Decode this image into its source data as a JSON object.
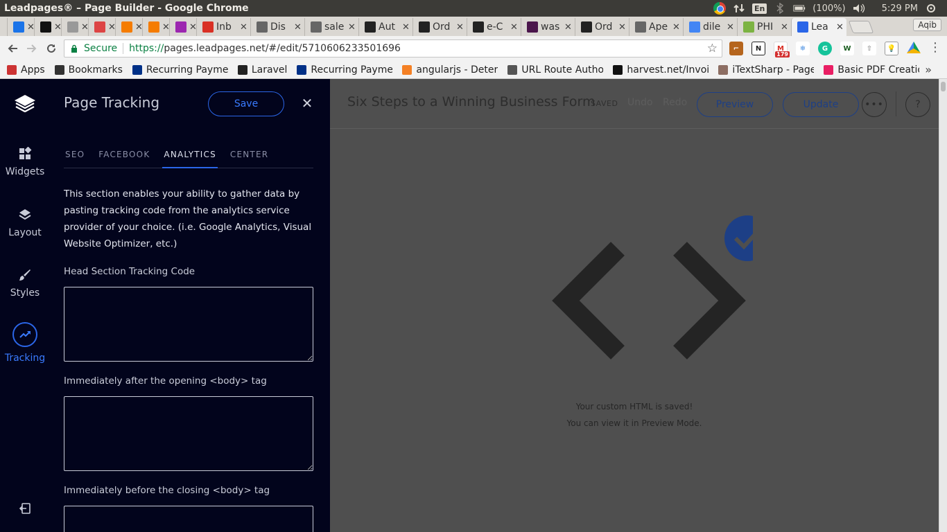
{
  "os": {
    "window_title": "Leadpages® – Page Builder - Google Chrome",
    "lang": "En",
    "battery": "(100%)",
    "time": "5:29 PM"
  },
  "tabs": [
    {
      "label": "",
      "icon": "refresh-favicon",
      "color": "#1a73e8"
    },
    {
      "label": "",
      "icon": "github-favicon",
      "color": "#111111"
    },
    {
      "label": "",
      "icon": "grid-favicon",
      "color": "#999999"
    },
    {
      "label": "",
      "icon": "tessel-favicon",
      "color": "#d44"
    },
    {
      "label": "",
      "icon": "bitbucket-favicon",
      "color": "#f57c00"
    },
    {
      "label": "",
      "icon": "bitbucket-favicon",
      "color": "#f57c00"
    },
    {
      "label": "",
      "icon": "prism-favicon",
      "color": "#9c27b0"
    },
    {
      "label": "Inb",
      "icon": "gmail-favicon",
      "color": "#d93025"
    },
    {
      "label": "Dis",
      "icon": "doc-favicon",
      "color": "#666666"
    },
    {
      "label": "sale",
      "icon": "doc-favicon",
      "color": "#666666"
    },
    {
      "label": "Aut",
      "icon": "bc-favicon",
      "color": "#222222"
    },
    {
      "label": "Ord",
      "icon": "bc-favicon",
      "color": "#222222"
    },
    {
      "label": "e-C",
      "icon": "bc-favicon",
      "color": "#222222"
    },
    {
      "label": "was",
      "icon": "slack-favicon",
      "color": "#4a154b"
    },
    {
      "label": "Ord",
      "icon": "bc-favicon",
      "color": "#222222"
    },
    {
      "label": "Ape",
      "icon": "doc-favicon",
      "color": "#666666"
    },
    {
      "label": "dile",
      "icon": "google-favicon",
      "color": "#4285f4"
    },
    {
      "label": "PHI",
      "icon": "php-favicon",
      "color": "#7cb342"
    },
    {
      "label": "Lea",
      "icon": "leadpages-favicon",
      "color": "#2b66e8",
      "active": true
    }
  ],
  "profile_name": "Aqib",
  "address": {
    "secure_label": "Secure",
    "url_scheme": "https://",
    "url_rest": "pages.leadpages.net/#/edit/5710606233501696"
  },
  "ext_badge": "179",
  "bookmarks": [
    {
      "label": "Apps",
      "icon": "apps-icon",
      "color": "#c33"
    },
    {
      "label": "Bookmarks",
      "icon": "star-icon",
      "color": "#333"
    },
    {
      "label": "Recurring Paymen",
      "icon": "paypal-icon",
      "color": "#003087"
    },
    {
      "label": "Laravel",
      "icon": "laravel-icon",
      "color": "#222"
    },
    {
      "label": "Recurring Paymen",
      "icon": "paypal-icon",
      "color": "#003087"
    },
    {
      "label": "angularjs - Determ",
      "icon": "stackoverflow-icon",
      "color": "#f48024"
    },
    {
      "label": "URL Route Author",
      "icon": "list-icon",
      "color": "#555"
    },
    {
      "label": "harvest.net/Invoic",
      "icon": "github-icon",
      "color": "#111"
    },
    {
      "label": "iTextSharp - Page l",
      "icon": "person-icon",
      "color": "#8d6e63"
    },
    {
      "label": "Basic PDF Creatio",
      "icon": "flask-icon",
      "color": "#e91e63"
    }
  ],
  "leftnav": [
    {
      "label": "Widgets",
      "icon": "widgets-icon"
    },
    {
      "label": "Layout",
      "icon": "layers-icon"
    },
    {
      "label": "Styles",
      "icon": "brush-icon"
    },
    {
      "label": "Tracking",
      "icon": "trending-icon",
      "active": true
    }
  ],
  "panel": {
    "title": "Page Tracking",
    "save_label": "Save",
    "tabs": [
      "SEO",
      "FACEBOOK",
      "ANALYTICS",
      "CENTER"
    ],
    "active_tab": "ANALYTICS",
    "description": "This section enables your ability to gather data by pasting tracking code from the analytics service provider of your choice. (i.e. Google Analytics, Visual Website Optimizer, etc.)",
    "fields": [
      {
        "label": "Head Section Tracking Code",
        "value": ""
      },
      {
        "label": "Immediately after the opening <body> tag",
        "value": ""
      },
      {
        "label": "Immediately before the closing <body> tag",
        "value": ""
      }
    ]
  },
  "main": {
    "doc_title": "Six Steps to a Winning Business Form",
    "saved_label": "SAVED",
    "undo_label": "Undo",
    "redo_label": "Redo",
    "preview_label": "Preview",
    "update_label": "Update",
    "more_label": "•••",
    "help_label": "?",
    "message_line1": "Your custom HTML is saved!",
    "message_line2": "You can view it in Preview Mode."
  },
  "colors": {
    "panel_bg": "#02041c",
    "accent": "#2b66e8",
    "check_badge": "#1d3f86"
  }
}
